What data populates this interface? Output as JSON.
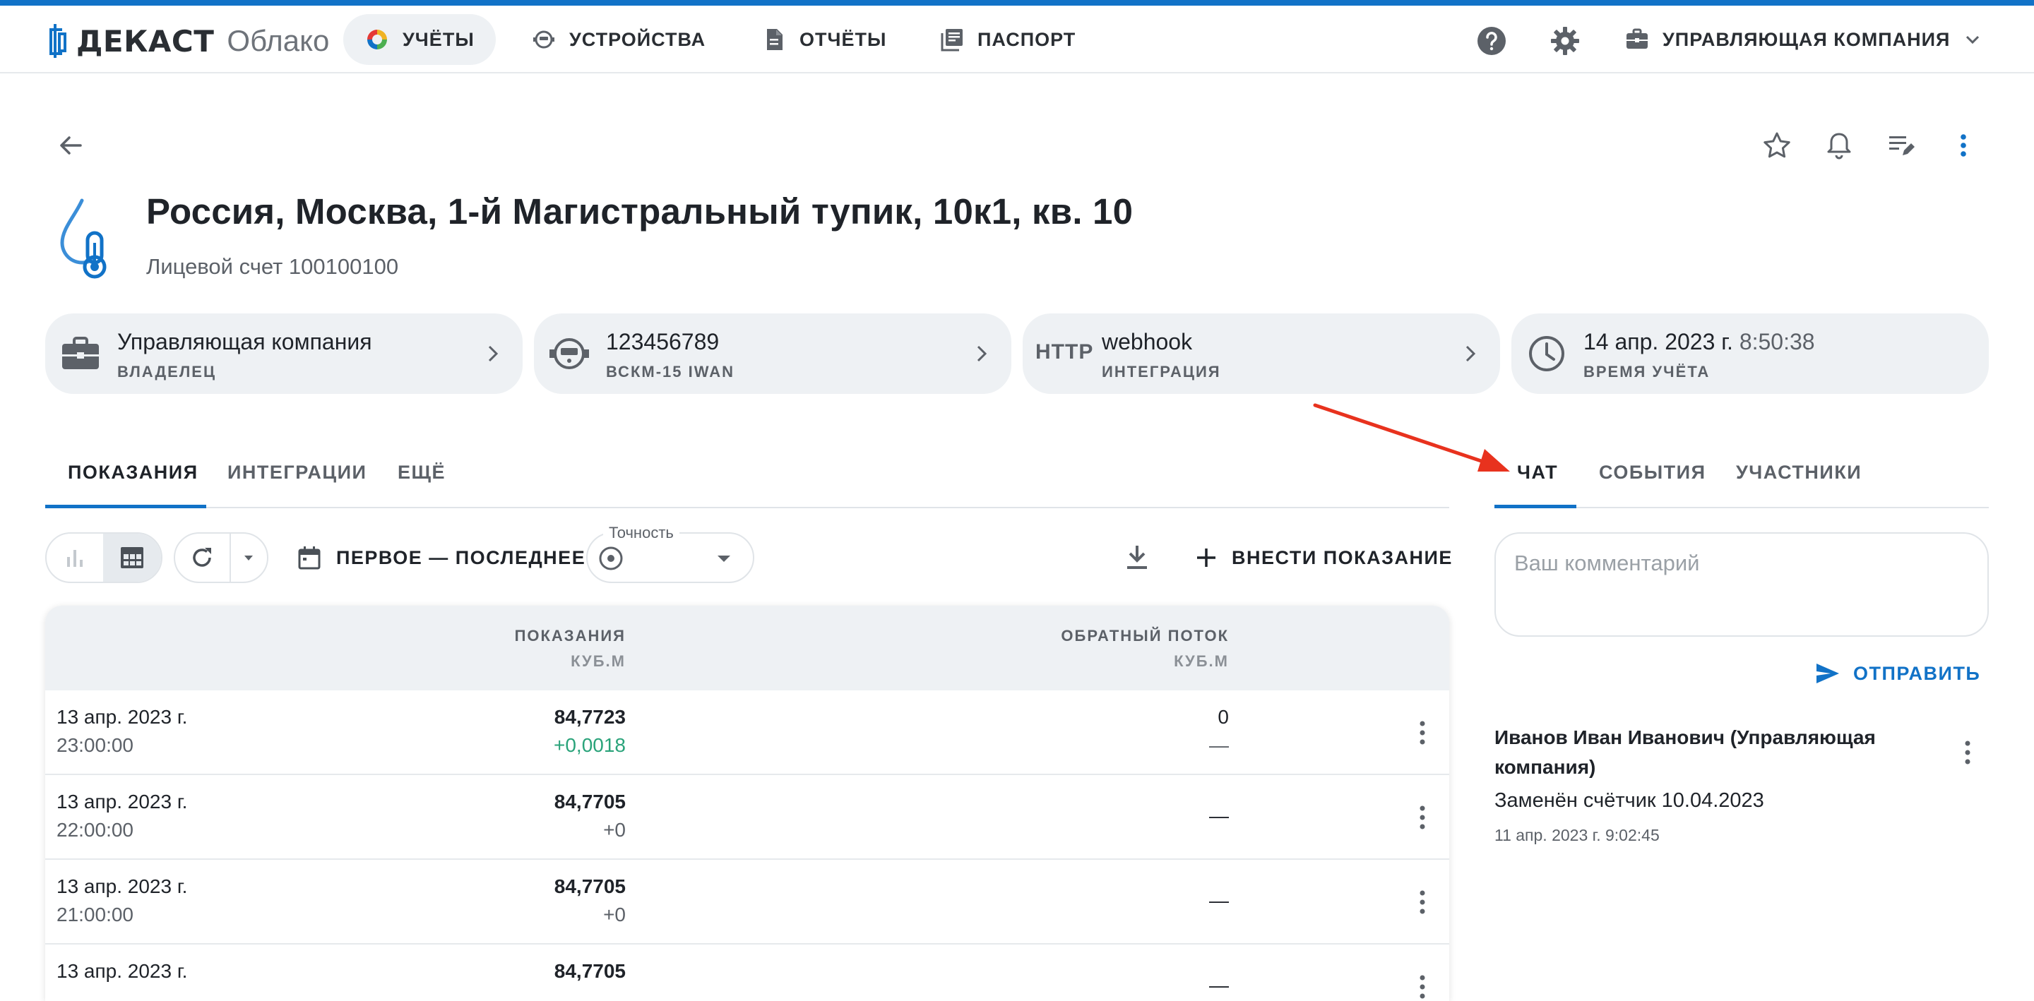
{
  "app": {
    "logo_name": "ДЕКАСТ",
    "logo_sub": "Облако",
    "accent_color": "#1172c7"
  },
  "nav": [
    {
      "label": "УЧЁТЫ",
      "icon": "circle-segments-icon",
      "active": true
    },
    {
      "label": "УСТРОЙСТВА",
      "icon": "meter-icon"
    },
    {
      "label": "ОТЧЁТЫ",
      "icon": "document-icon"
    },
    {
      "label": "ПАСПОРТ",
      "icon": "book-icon"
    }
  ],
  "topbar": {
    "company_label": "УПРАВЛЯЮЩАЯ КОМПАНИЯ",
    "help_icon": "help-icon",
    "settings_icon": "gear-icon"
  },
  "header": {
    "title": "Россия, Москва, 1-й Магистральный тупик, 10к1, кв. 10",
    "subtitle": "Лицевой счет 100100100"
  },
  "cards": [
    {
      "main": "Управляющая компания",
      "sub": "ВЛАДЕЛЕЦ",
      "icon": "briefcase-icon"
    },
    {
      "main": "123456789",
      "sub": "ВСКМ-15 IWAN",
      "icon": "water-meter-icon"
    },
    {
      "main": "webhook",
      "sub": "ИНТЕГРАЦИЯ",
      "icon_text": "HTTP"
    },
    {
      "date": "14 апр. 2023 г.",
      "time": "8:50:38",
      "sub": "ВРЕМЯ УЧЁТА",
      "icon": "clock-icon"
    }
  ],
  "tabs_left": [
    {
      "label": "ПОКАЗАНИЯ",
      "active": true
    },
    {
      "label": "ИНТЕГРАЦИИ"
    },
    {
      "label": "ЕЩЁ"
    }
  ],
  "tabs_right": [
    {
      "label": "ЧАТ",
      "active": true
    },
    {
      "label": "СОБЫТИЯ"
    },
    {
      "label": "УЧАСТНИКИ"
    }
  ],
  "toolbar": {
    "period_label": "ПЕРВОЕ — ПОСЛЕДНЕЕ",
    "precision_label": "Точность",
    "add_label": "ВНЕСТИ ПОКАЗАНИЕ"
  },
  "table": {
    "columns": [
      {
        "title": "ПОКАЗАНИЯ",
        "unit": "КУБ.М"
      },
      {
        "title": "ОБРАТНЫЙ ПОТОК",
        "unit": "КУБ.М"
      }
    ],
    "rows": [
      {
        "date": "13 апр. 2023 г.",
        "time": "23:00:00",
        "value": "84,7723",
        "delta": "+0,0018",
        "delta_positive": true,
        "reverse": "0",
        "reverse_delta": "—"
      },
      {
        "date": "13 апр. 2023 г.",
        "time": "22:00:00",
        "value": "84,7705",
        "delta": "+0",
        "reverse": "—"
      },
      {
        "date": "13 апр. 2023 г.",
        "time": "21:00:00",
        "value": "84,7705",
        "delta": "+0",
        "reverse": "—"
      },
      {
        "date": "13 апр. 2023 г.",
        "time": "",
        "value": "84,7705",
        "delta": "",
        "reverse": "—"
      }
    ]
  },
  "chat": {
    "placeholder": "Ваш комментарий",
    "send_label": "ОТПРАВИТЬ",
    "messages": [
      {
        "author": "Иванов Иван Иванович (Управляющая компания)",
        "text": "Заменён счётчик 10.04.2023",
        "date": "11 апр. 2023 г. 9:02:45"
      }
    ]
  }
}
